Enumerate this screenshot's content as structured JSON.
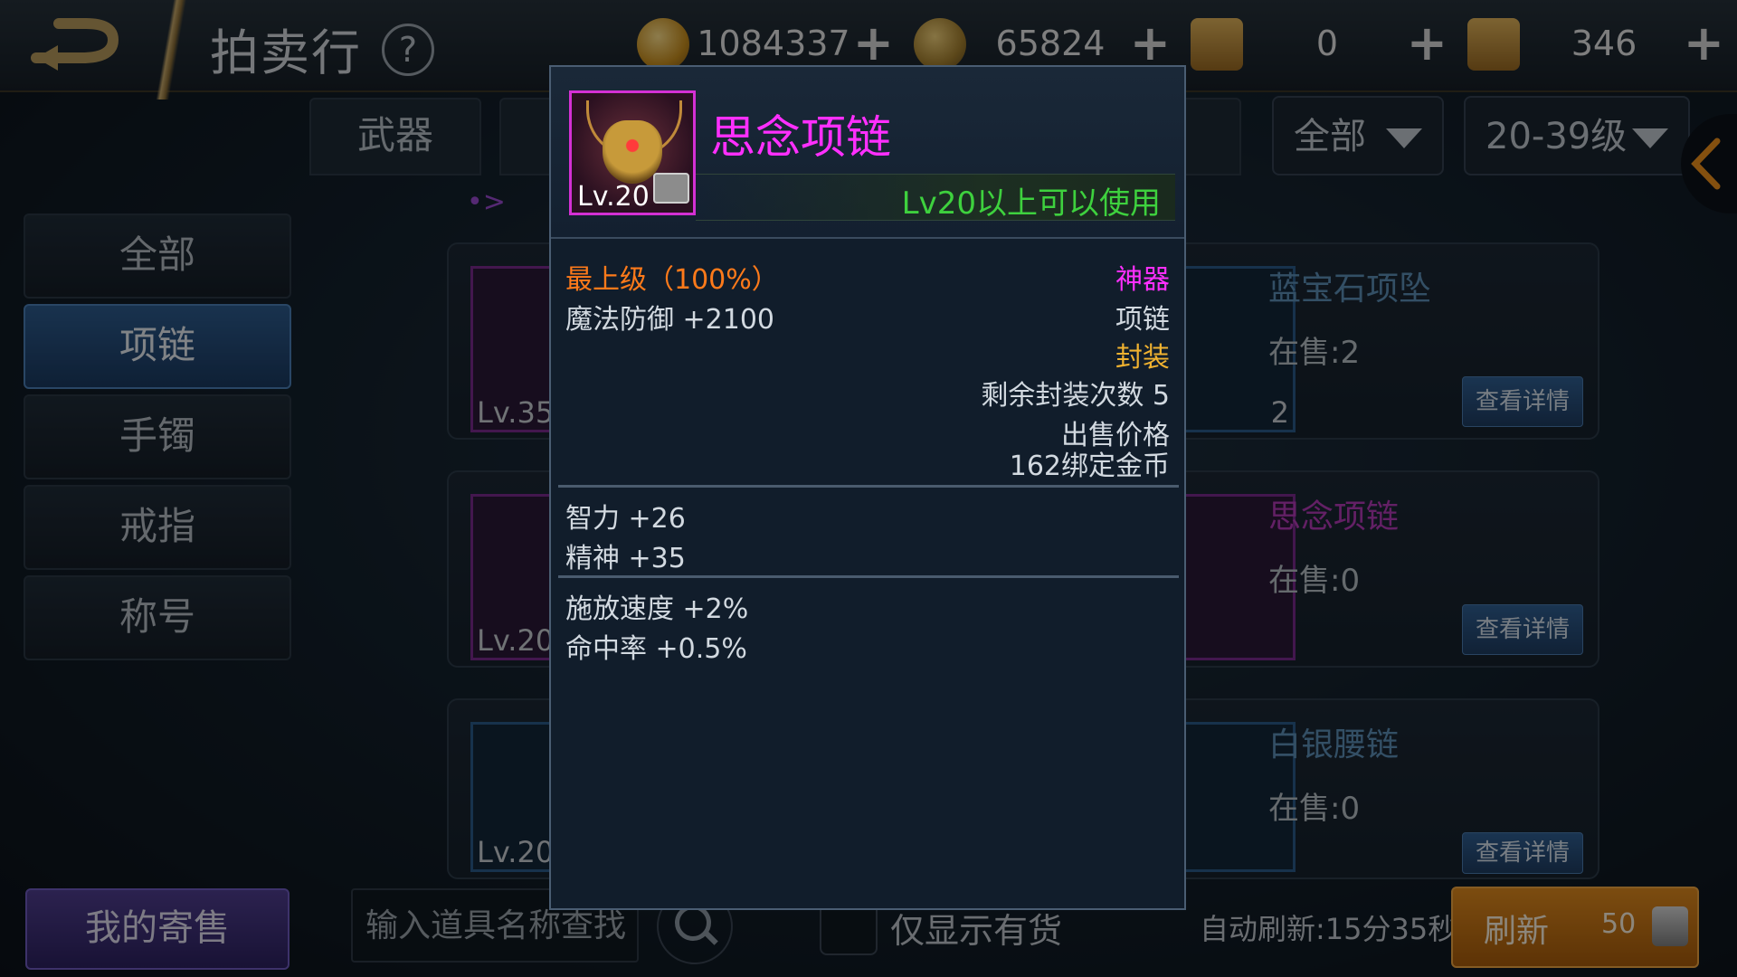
{
  "header": {
    "title": "拍卖行",
    "help_icon": "?",
    "currencies": [
      {
        "icon": "gold-coin-icon",
        "value": "1084337"
      },
      {
        "icon": "bound-coin-icon",
        "value": "65824"
      },
      {
        "icon": "scroll-icon",
        "value": "0"
      },
      {
        "icon": "locked-scroll-icon",
        "value": "346"
      }
    ],
    "plus": "+"
  },
  "tabs": {
    "category_partial": "武器",
    "filter_all": "全部",
    "level_range": "20-39级"
  },
  "pager": "•>",
  "sidebar": {
    "items": [
      {
        "label": "全部"
      },
      {
        "label": "项链",
        "active": true
      },
      {
        "label": "手镯"
      },
      {
        "label": "戒指"
      },
      {
        "label": "称号"
      }
    ]
  },
  "listings": [
    {
      "left_lv": "Lv.35",
      "name": "蓝宝石项坠",
      "stock": "在售:2",
      "badge": "2",
      "button": "查看详情"
    },
    {
      "left_lv": "Lv.20",
      "name": "思念项链",
      "stock": "在售:0",
      "button": "查看详情"
    },
    {
      "left_lv": "Lv.20",
      "name": "白银腰链",
      "stock": "在售:0",
      "button": "查看详情"
    }
  ],
  "bottom": {
    "my_sales": "我的寄售",
    "search_placeholder": "输入道具名称查找",
    "in_stock_only": "仅显示有货",
    "auto_refresh": "自动刷新:15分35秒",
    "refresh_label": "刷新",
    "refresh_cost": "50"
  },
  "tooltip": {
    "icon_level": "Lv.20",
    "name": "思念项链",
    "requirement": "Lv20以上可以使用",
    "grade": "最上级（100%）",
    "rarity": "神器",
    "main_stat": "魔法防御 +2100",
    "item_type": "项链",
    "sealed": "封装",
    "seal_remaining": "剩余封装次数 5",
    "sell_price_label": "出售价格",
    "sell_price_value": "162绑定金币",
    "attributes": [
      "智力 +26",
      "精神 +35"
    ],
    "bonuses": [
      "施放速度 +2%",
      "命中率 +0.5%"
    ]
  },
  "colors": {
    "name_purple": "#ff2fff",
    "requirement_green": "#3ed13e",
    "grade_orange": "#ff7a1a",
    "seal_gold": "#f0b230",
    "tooltip_bg": "#111d2b"
  }
}
